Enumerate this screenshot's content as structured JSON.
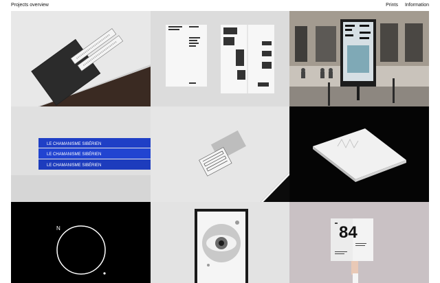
{
  "header": {
    "title": "Projects overview",
    "nav": [
      {
        "label": "Prints"
      },
      {
        "label": "Information"
      }
    ]
  },
  "tiles": [
    {
      "name": "project-black-book-with-bookmarks"
    },
    {
      "name": "project-printed-program-booklet"
    },
    {
      "name": "project-street-billboard-collective"
    },
    {
      "name": "project-le-chamanisme-books",
      "spine_texts": [
        "LE CHAMANISME SIBÉRIEN",
        "LE CHAMANISME SIBÉRIEN",
        "LE CHAMANISME SIBÉRIEN"
      ]
    },
    {
      "name": "project-folded-cards"
    },
    {
      "name": "project-white-book-on-black"
    },
    {
      "name": "project-n-circle-logo",
      "letter": "N"
    },
    {
      "name": "project-framed-eye-poster"
    },
    {
      "name": "project-84-booklet-in-hand",
      "number": "84"
    }
  ],
  "colors": {
    "book_blue": "#1f3fc6",
    "black": "#000000",
    "light_gray": "#e6e6e6"
  }
}
